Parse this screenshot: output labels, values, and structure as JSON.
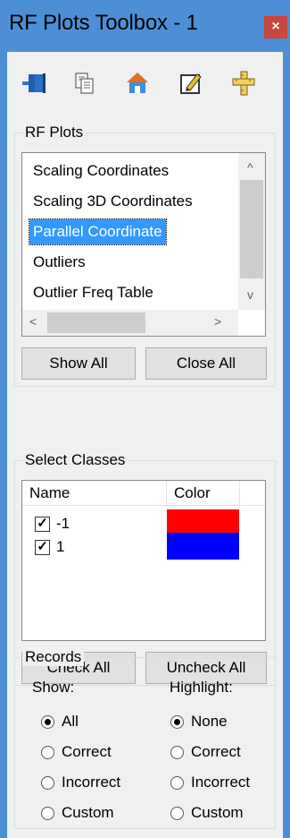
{
  "window": {
    "title": "RF Plots Toolbox - 1",
    "close_glyph": "×"
  },
  "toolbar": {
    "icons": [
      "book-icon",
      "copy-icon",
      "home-icon",
      "edit-icon",
      "ruler-icon"
    ]
  },
  "rf_plots": {
    "legend": "RF Plots",
    "items": [
      "Scaling Coordinates",
      "Scaling 3D Coordinates",
      "Parallel Coordinate",
      "Outliers",
      "Outlier Freq Table"
    ],
    "selected_index": 2,
    "scroll_up": "^",
    "scroll_down": "v",
    "scroll_left": "<",
    "scroll_right": ">",
    "show_all_label": "Show All",
    "close_all_label": "Close All"
  },
  "select_classes": {
    "legend": "Select Classes",
    "col_name": "Name",
    "col_color": "Color",
    "classes": [
      {
        "name": "-1",
        "checked": true,
        "color": "#ff0000"
      },
      {
        "name": "1",
        "checked": true,
        "color": "#0000ff"
      }
    ],
    "check_all_label": "Check All",
    "uncheck_all_label": "Uncheck All"
  },
  "records": {
    "legend": "Records",
    "show_label": "Show:",
    "highlight_label": "Highlight:",
    "show_options": [
      "All",
      "Correct",
      "Incorrect",
      "Custom"
    ],
    "show_selected": "All",
    "highlight_options": [
      "None",
      "Correct",
      "Incorrect",
      "Custom"
    ],
    "highlight_selected": "None"
  }
}
